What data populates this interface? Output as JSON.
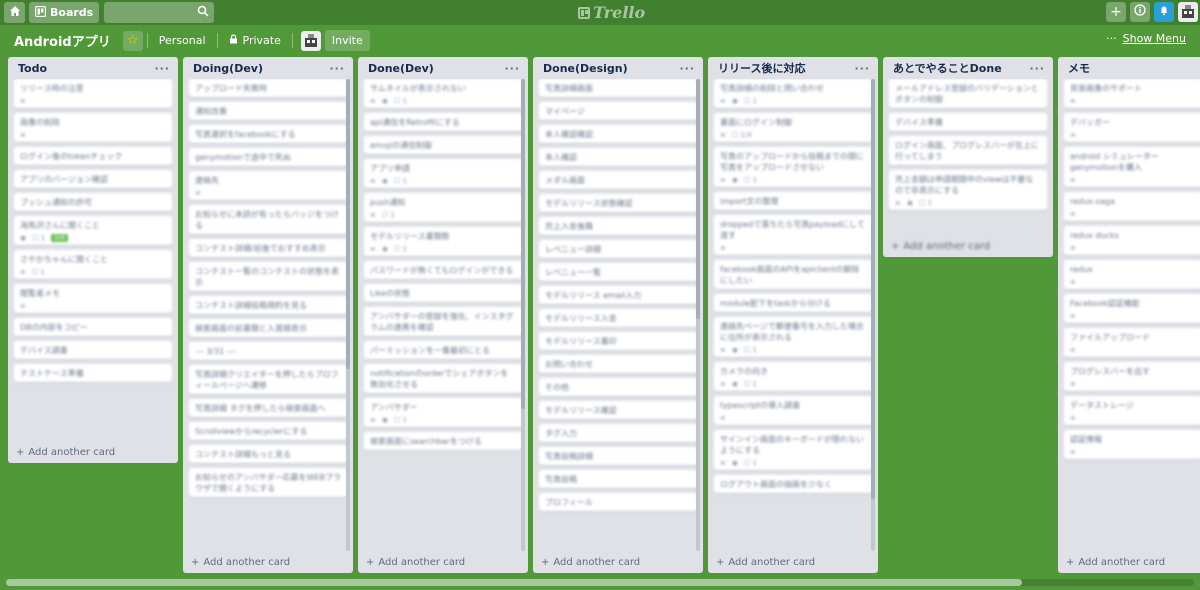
{
  "topbar": {
    "boards_label": "Boards",
    "search_placeholder": "",
    "logo_text": "Trello",
    "add_icon": "plus-icon",
    "info_icon": "info-icon",
    "notification_icon": "bell-icon"
  },
  "board": {
    "title": "Androidアプリ",
    "visibility_team": "Personal",
    "visibility_privacy": "Private",
    "invite_label": "Invite",
    "show_menu_label": "Show Menu",
    "more_label": "···"
  },
  "add_card_label": "Add another card",
  "colors": {
    "board_bg": "#519839",
    "topbar_bg": "#41802e",
    "list_bg": "#dfe1e6",
    "card_bg": "#ffffff",
    "label_green": "#61bd4f"
  },
  "lists": [
    {
      "title": "Todo",
      "cards": [
        {
          "text": "リリース時の注意",
          "badges": [
            "≡"
          ]
        },
        {
          "text": "画像の削除",
          "badges": [
            "≡"
          ]
        },
        {
          "text": "ログイン後のtokenチェック",
          "badges": []
        },
        {
          "text": "アプリのバージョン確認",
          "badges": []
        },
        {
          "text": "プッシュ通知の許可",
          "badges": []
        },
        {
          "text": "海馬沢さんに聞くこと",
          "badges": [
            "◉",
            "☐ 1"
          ],
          "check": "0/6"
        },
        {
          "text": "さやかちゃんに聞くこと",
          "badges": [
            "≡",
            "☐ 1"
          ]
        },
        {
          "text": "閲覧者メモ",
          "badges": [
            "≡"
          ]
        },
        {
          "text": "DBの内容をコピー",
          "badges": []
        },
        {
          "text": "デバイス調査",
          "badges": []
        },
        {
          "text": "テストケース準備",
          "badges": []
        }
      ]
    },
    {
      "title": "Doing(Dev)",
      "cards": [
        {
          "text": "アップロード失敗時",
          "badges": []
        },
        {
          "text": "通知改善",
          "badges": []
        },
        {
          "text": "写真選択をfacebookにする",
          "badges": []
        },
        {
          "text": "genymotionで途中で死ぬ",
          "badges": []
        },
        {
          "text": "連絡先",
          "badges": [
            "≡"
          ]
        },
        {
          "text": "お知らせに未読が有ったらバッジをつける",
          "badges": []
        },
        {
          "text": "コンテスト詳細/前後でおすすめ表示",
          "badges": []
        },
        {
          "text": "コンテスト一覧のコンテストの状態を表示",
          "badges": []
        },
        {
          "text": "コンテスト詳細投稿規約を見る",
          "badges": []
        },
        {
          "text": "検索画面の前書類と入賞順表示",
          "badges": []
        },
        {
          "text": "--- 3/31 ---",
          "badges": []
        },
        {
          "text": "写真詳細クリエイターを押したらプロフィールページへ遷移",
          "badges": []
        },
        {
          "text": "写真詳細 タグを押したら検索画面へ",
          "badges": []
        },
        {
          "text": "Scrollviewからrecyclerにする",
          "badges": []
        },
        {
          "text": "コンテスト詳細もっと見る",
          "badges": []
        },
        {
          "text": "お知らせのアンバサダー応募をWEBブラウザで開くようにする",
          "badges": []
        }
      ]
    },
    {
      "title": "Done(Dev)",
      "cards": [
        {
          "text": "サムネイルが表示されない",
          "badges": [
            "≡",
            "◉",
            "☐ 1"
          ]
        },
        {
          "text": "api通信をRetrofitにする",
          "badges": []
        },
        {
          "text": "emojiの通信制御",
          "badges": []
        },
        {
          "text": "アプリ申請",
          "badges": [
            "≡",
            "◉",
            "☐ 1"
          ]
        },
        {
          "text": "push通知",
          "badges": [
            "≡",
            "☐ 1"
          ]
        },
        {
          "text": "モデルリリース書類数",
          "badges": [
            "≡",
            "◉",
            "☐ 1"
          ]
        },
        {
          "text": "パスワードが無くてもログインができる",
          "badges": []
        },
        {
          "text": "Likeの状態",
          "badges": []
        },
        {
          "text": "アンバサダーの登録を強化、インスタグラムの連携を確認",
          "badges": []
        },
        {
          "text": "パーミッションを一番最初にとる",
          "badges": []
        },
        {
          "text": "notificationのorderでシェアボタンを無効化させる",
          "badges": []
        },
        {
          "text": "アンバサダー",
          "badges": [
            "≡",
            "◉",
            "☐ 1"
          ]
        },
        {
          "text": "検索画面にsearchbarをつける",
          "badges": []
        }
      ]
    },
    {
      "title": "Done(Design)",
      "cards": [
        {
          "text": "写真詳細画面",
          "badges": []
        },
        {
          "text": "マイページ",
          "badges": []
        },
        {
          "text": "本人確認確認",
          "badges": []
        },
        {
          "text": "本人確認",
          "badges": []
        },
        {
          "text": "メダル画面",
          "badges": []
        },
        {
          "text": "モデルリリース状態確認",
          "badges": []
        },
        {
          "text": "売上入金後職",
          "badges": []
        },
        {
          "text": "レベニュー詳細",
          "badges": []
        },
        {
          "text": "レベニュー一覧",
          "badges": []
        },
        {
          "text": "モデルリリース email入力",
          "badges": []
        },
        {
          "text": "モデルリリース入金",
          "badges": []
        },
        {
          "text": "モデルリリース署印",
          "badges": []
        },
        {
          "text": "お問い合わせ",
          "badges": []
        },
        {
          "text": "その他",
          "badges": []
        },
        {
          "text": "モデルリリース確認",
          "badges": []
        },
        {
          "text": "タグ入力",
          "badges": []
        },
        {
          "text": "写真投稿詳細",
          "badges": []
        },
        {
          "text": "写真投稿",
          "badges": []
        },
        {
          "text": "プロフィール",
          "badges": []
        }
      ]
    },
    {
      "title": "リリース後に対応",
      "cards": [
        {
          "text": "写真詳細の削除と問い合わせ",
          "badges": [
            "≡",
            "◉",
            "☐ 1"
          ]
        },
        {
          "text": "書面にログイン制御",
          "badges": [
            "≡",
            "☐ 1/4"
          ]
        },
        {
          "text": "写真のアップロードから投稿までの間に写真をアップロードさせない",
          "badges": [
            "≡",
            "◉",
            "☐ 1"
          ]
        },
        {
          "text": "import文の整理",
          "badges": []
        },
        {
          "text": "droppedで落ちたら写真payloadにして渡す",
          "badges": [
            "≡"
          ]
        },
        {
          "text": "facebook画面のAPIをapiclientの解除にしたい",
          "badges": []
        },
        {
          "text": "module配下をtaskから分ける",
          "badges": []
        },
        {
          "text": "連絡先ページで郵便番号を入力した場合に住所が表示される",
          "badges": [
            "≡",
            "◉",
            "☐ 1"
          ]
        },
        {
          "text": "カメラの向き",
          "badges": [
            "≡",
            "◉",
            "☐ 1"
          ]
        },
        {
          "text": "typescriptの導入調査",
          "badges": [
            "≡"
          ]
        },
        {
          "text": "サインイン画面のキーボードが隠れないようにする",
          "badges": [
            "≡",
            "◉",
            "☐ 1"
          ]
        },
        {
          "text": "ログアウト画面の描画を少なく",
          "badges": []
        }
      ]
    },
    {
      "title": "あとでやることDone",
      "cards": [
        {
          "text": "メールアドレス登録のバリデーションとボタンの制御",
          "badges": []
        },
        {
          "text": "デバイス準備",
          "badges": []
        },
        {
          "text": "ログイン画面、プログレスバーが左上に行ってしまう",
          "badges": []
        },
        {
          "text": "売上金額は申請期間中のviewは不要なので非表示にする",
          "badges": [
            "≡",
            "◉",
            "☐ 1"
          ]
        }
      ]
    },
    {
      "title": "メモ",
      "cards": [
        {
          "text": "背景画像のサポート",
          "badges": [
            "≡"
          ]
        },
        {
          "text": "デバッガー",
          "badges": [
            "≡"
          ]
        },
        {
          "text": "android シミュレーターgenymotionを購入",
          "badges": [
            "≡"
          ]
        },
        {
          "text": "redux-saga",
          "badges": [
            "≡"
          ]
        },
        {
          "text": "redux ducks",
          "badges": [
            "≡"
          ]
        },
        {
          "text": "redux",
          "badges": [
            "≡"
          ]
        },
        {
          "text": "Facebook認証機能",
          "badges": [
            "≡"
          ]
        },
        {
          "text": "ファイルアップロード",
          "badges": [
            "≡"
          ]
        },
        {
          "text": "プログレスバーを出す",
          "badges": [
            "≡"
          ]
        },
        {
          "text": "データストレージ",
          "badges": [
            "≡"
          ]
        },
        {
          "text": "認証情報",
          "badges": [
            "≡"
          ]
        }
      ]
    }
  ]
}
